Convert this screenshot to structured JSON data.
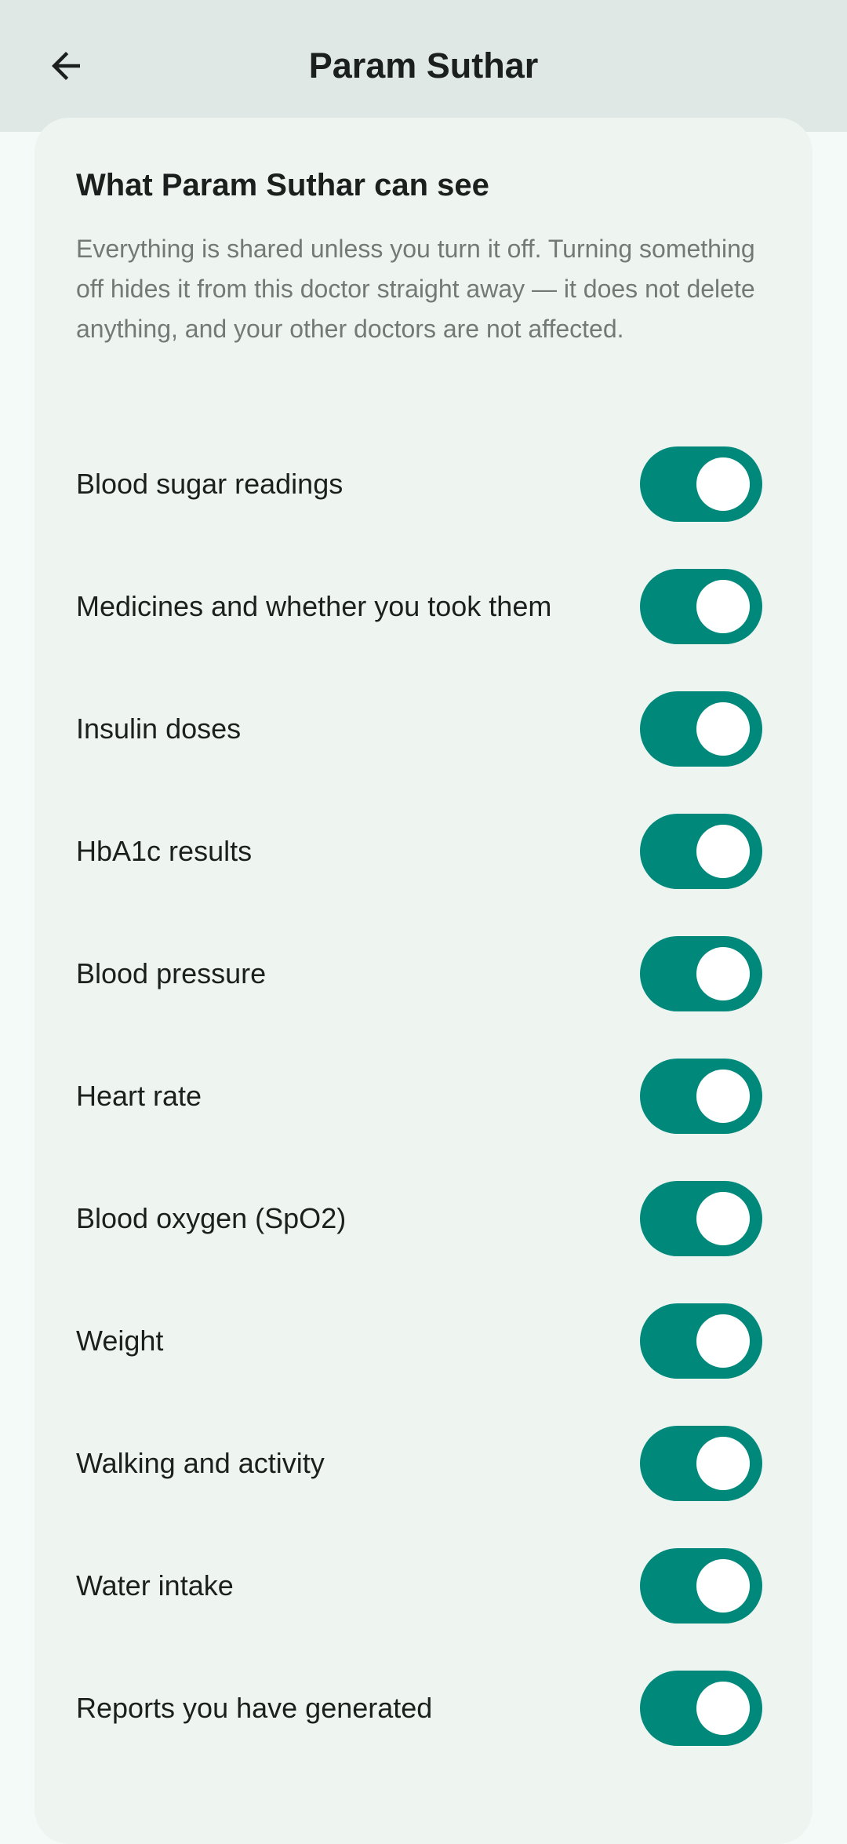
{
  "app_bar": {
    "title": "Param Suthar"
  },
  "sharing": {
    "title": "What Param Suthar can see",
    "description": "Everything is shared unless you turn it off. Turning something off hides it from this doctor straight away — it does not delete anything, and your other doctors are not affected.",
    "items": [
      {
        "label": "Blood sugar readings",
        "enabled": true
      },
      {
        "label": "Medicines and whether you took them",
        "enabled": true
      },
      {
        "label": "Insulin doses",
        "enabled": true
      },
      {
        "label": "HbA1c results",
        "enabled": true
      },
      {
        "label": "Blood pressure",
        "enabled": true
      },
      {
        "label": "Heart rate",
        "enabled": true
      },
      {
        "label": "Blood oxygen (SpO2)",
        "enabled": true
      },
      {
        "label": "Weight",
        "enabled": true
      },
      {
        "label": "Walking and activity",
        "enabled": true
      },
      {
        "label": "Water intake",
        "enabled": true
      },
      {
        "label": "Reports you have generated",
        "enabled": true
      }
    ]
  },
  "colors": {
    "app_bar_bg": "#dfe8e4",
    "page_bg": "#f4faf7",
    "card_bg": "#eef5f1",
    "toggle_on": "#00897b",
    "description_text": "#737a76"
  },
  "icons": {
    "back": "arrow-back-icon"
  }
}
